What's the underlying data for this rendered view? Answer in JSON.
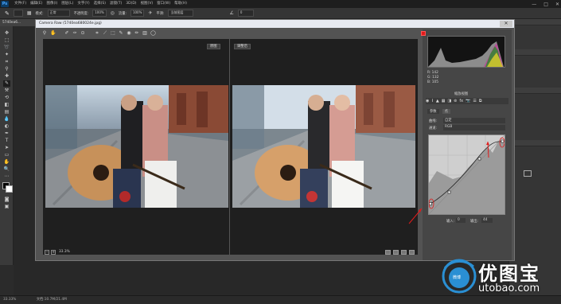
{
  "app": {
    "name": "Ps"
  },
  "menu": [
    "文件(F)",
    "编辑(E)",
    "图像(I)",
    "图层(L)",
    "文字(Y)",
    "选择(S)",
    "滤镜(T)",
    "3D(D)",
    "视图(V)",
    "窗口(W)",
    "帮助(H)"
  ],
  "window_controls": [
    "—",
    "□",
    "✕"
  ],
  "options_bar": {
    "mode_label": "模式:",
    "mode_value": "正常",
    "opacity_label": "不透明度:",
    "opacity_value": "100%",
    "flow_label": "流量:",
    "flow_value": "100%",
    "smoothing_label": "平滑:",
    "sample_label": "当前图层",
    "angle_value": "0"
  },
  "document_tab": "5740ea6...",
  "status_bar": {
    "zoom": "33.33%",
    "doc_info": "文档:10.7M/21.4M"
  },
  "camera_raw": {
    "title": "Camera Raw (5740ea680024e.jpg)",
    "before_label": "原图",
    "after_label": "调整后",
    "zoom_value": "33.3%",
    "hist_readout": {
      "r": "R: 142",
      "g": "G: 132",
      "b": "B: 105"
    },
    "profile_label": "缩放视图",
    "tabs": {
      "parametric": "参数",
      "point": "点"
    },
    "curve_label": "曲线:",
    "curve_value": "自定",
    "channel_label": "通道:",
    "channel_value": "RGB",
    "input_label": "输入:",
    "input_value": "0",
    "output_label": "输出:",
    "output_value": "44"
  },
  "watermark": {
    "brand": "优图宝",
    "url": "utobao.com",
    "icon_text": "微博"
  },
  "colors": {
    "accent_red": "#e01b1b",
    "watermark_blue": "#2a8fd3",
    "curve_bg": "#cfcfcf"
  }
}
